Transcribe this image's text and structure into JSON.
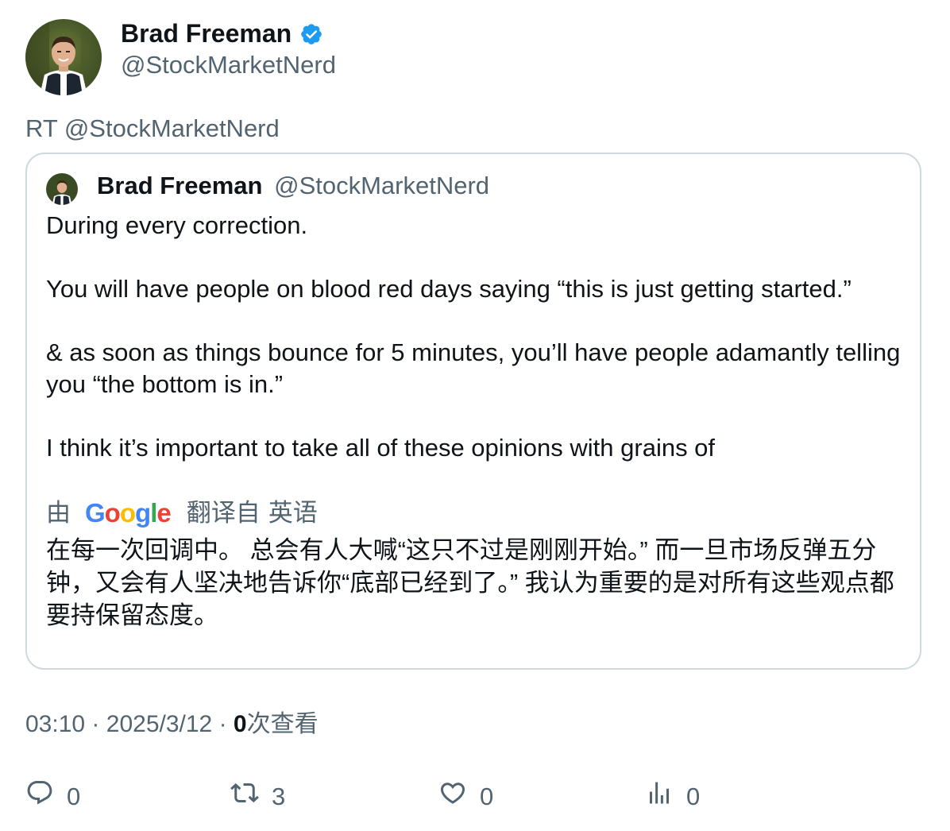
{
  "tweet": {
    "author": {
      "name": "Brad Freeman",
      "handle": "@StockMarketNerd",
      "verified": true
    },
    "retweet_label": "RT @StockMarketNerd",
    "quoted": {
      "name": "Brad Freeman",
      "handle": "@StockMarketNerd",
      "paragraphs": [
        "During every correction.",
        "You will have people on blood red days saying “this is just getting started.”",
        "& as soon as things bounce for 5 minutes, you’ll have people adamantly telling you “the bottom is in.”",
        "I think it’s important to take all of these opinions with grains of"
      ],
      "translation": {
        "prefix": "由",
        "provider": "Google",
        "suffix": "翻译自",
        "language": "英语",
        "text": "在每一次回调中。 总会有人大喊“这只不过是刚刚开始。” 而一旦市场反弹五分钟，又会有人坚决地告诉你“底部已经到了。” 我认为重要的是对所有这些观点都要持保留态度。"
      }
    },
    "meta": {
      "time": "03:10",
      "separator": "·",
      "date": "2025/3/12",
      "views_count": "0",
      "views_label": "次查看"
    },
    "actions": {
      "replies": "0",
      "retweets": "3",
      "likes": "0",
      "views": "0"
    }
  },
  "colors": {
    "text_primary": "#0f1419",
    "text_secondary": "#536471",
    "border": "#cfd9de",
    "verified_blue": "#1d9bf0"
  },
  "icons": [
    "verified-badge-icon",
    "reply-icon",
    "retweet-icon",
    "like-icon",
    "views-icon"
  ]
}
